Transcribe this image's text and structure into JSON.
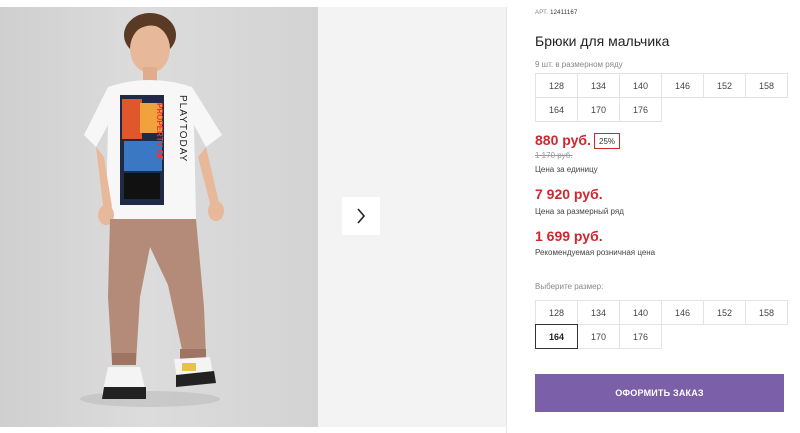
{
  "product": {
    "art_prefix": "АРТ.",
    "art_number": "12411167",
    "title": "Брюки для мальчика"
  },
  "size_row": {
    "hint": "9 шт. в размерном ряду",
    "sizes": [
      "128",
      "134",
      "140",
      "146",
      "152",
      "158",
      "164",
      "170",
      "176"
    ]
  },
  "pricing": {
    "unit_price": "880 руб.",
    "discount_badge": "25%",
    "old_price": "1 170 руб.",
    "unit_caption": "Цена за единицу",
    "row_price": "7 920 руб.",
    "row_caption": "Цена за размерный ряд",
    "retail_price": "1 699 руб.",
    "retail_caption": "Рекомендуемая розничная цена"
  },
  "size_picker": {
    "hint": "Выберите размер:",
    "sizes": [
      "128",
      "134",
      "140",
      "146",
      "152",
      "158",
      "164",
      "170",
      "176"
    ],
    "selected": "164"
  },
  "order_button": "ОФОРМИТЬ ЗАКАЗ",
  "photo": {
    "shirt_print_text": "PLAYTODAY",
    "shirt_print_text_2": "PROPERTY OF"
  },
  "colors": {
    "price_red": "#d0262f",
    "order_purple": "#7b5fa8",
    "pants_brown": "#b48a78"
  }
}
